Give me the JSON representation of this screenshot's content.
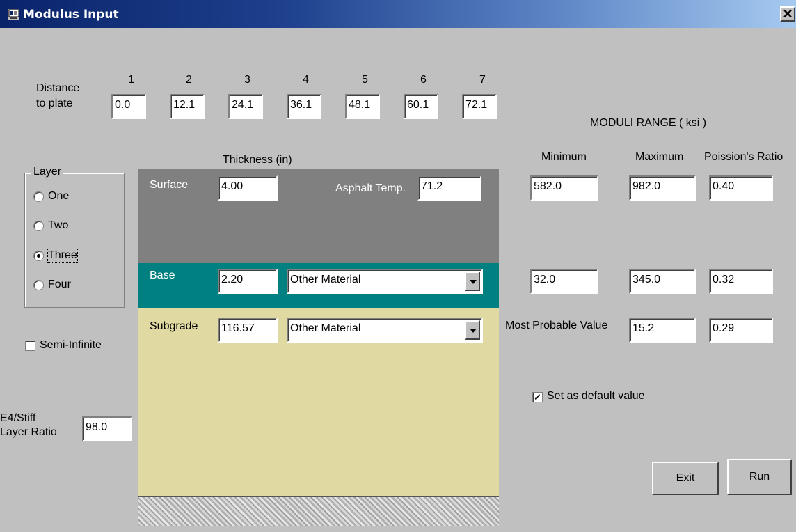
{
  "window": {
    "title": "Modulus Input",
    "close_glyph": "✕"
  },
  "distance": {
    "label_line1": "Distance",
    "label_line2": "to plate",
    "sensors": [
      {
        "num": "1",
        "value": "0.0"
      },
      {
        "num": "2",
        "value": "12.1"
      },
      {
        "num": "3",
        "value": "24.1"
      },
      {
        "num": "4",
        "value": "36.1"
      },
      {
        "num": "5",
        "value": "48.1"
      },
      {
        "num": "6",
        "value": "60.1"
      },
      {
        "num": "7",
        "value": "72.1"
      }
    ]
  },
  "layer": {
    "legend": "Layer",
    "options": [
      "One",
      "Two",
      "Three",
      "Four"
    ],
    "selected": "Three"
  },
  "semi_infinite": {
    "label": "Semi-Infinite",
    "checked": false
  },
  "e4_ratio": {
    "label_line1": "E4/Stiff",
    "label_line2": "Layer Ratio",
    "value": "98.0"
  },
  "thickness_header": "Thickness (in)",
  "surface": {
    "label": "Surface",
    "thickness": "4.00",
    "temp_label": "Asphalt Temp.",
    "temp_value": "71.2"
  },
  "base": {
    "label": "Base",
    "thickness": "2.20",
    "material": "Other Material"
  },
  "subgrade": {
    "label": "Subgrade",
    "thickness": "116.57",
    "material": "Other Material"
  },
  "moduli": {
    "header": "MODULI RANGE  ( ksi )",
    "col_min": "Minimum",
    "col_max": "Maximum",
    "col_ratio": "Poission's Ratio",
    "surface": {
      "min": "582.0",
      "max": "982.0",
      "ratio": "0.40"
    },
    "base": {
      "min": "32.0",
      "max": "345.0",
      "ratio": "0.32"
    },
    "subgrade": {
      "label": "Most Probable Value",
      "value": "15.2",
      "ratio": "0.29"
    }
  },
  "default_value": {
    "label": "Set as default value",
    "checked": true
  },
  "buttons": {
    "exit": "Exit",
    "run": "Run"
  },
  "colors": {
    "surface": "#808080",
    "base": "#008080",
    "subgrade": "#e1d9a2",
    "titlebar": "#0a246a"
  }
}
